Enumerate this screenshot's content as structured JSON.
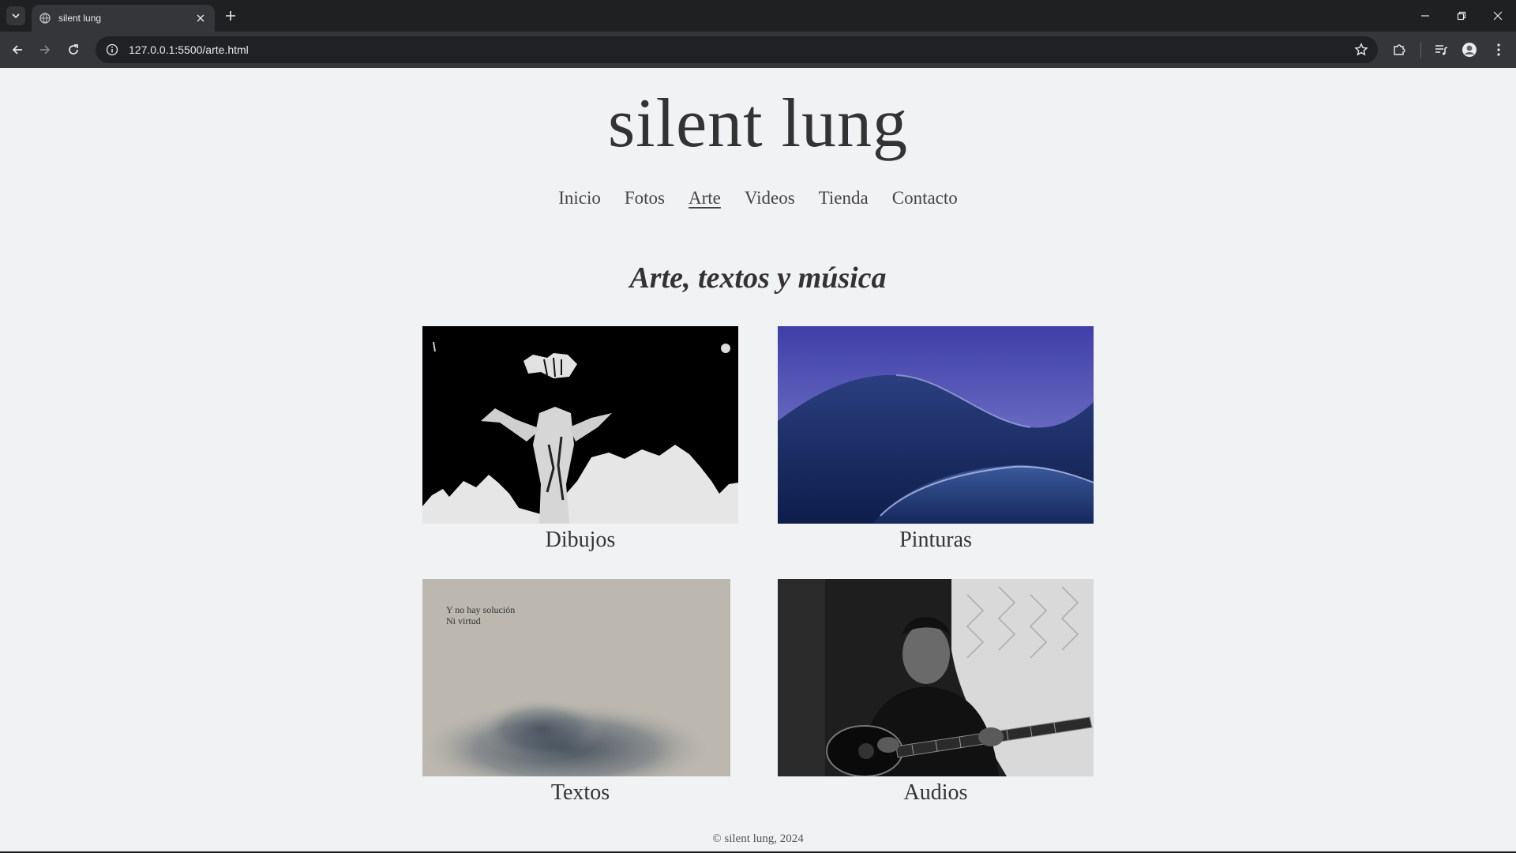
{
  "browser": {
    "tab_title": "silent lung",
    "url": "127.0.0.1:5500/arte.html"
  },
  "site": {
    "title": "silent lung",
    "nav": [
      "Inicio",
      "Fotos",
      "Arte",
      "Videos",
      "Tienda",
      "Contacto"
    ],
    "active_nav": "Arte",
    "section_title": "Arte, textos y música",
    "cards": [
      {
        "caption": "Dibujos"
      },
      {
        "caption": "Pinturas"
      },
      {
        "caption": "Textos",
        "image_text": [
          "Y no hay solución",
          "Ni virtud"
        ]
      },
      {
        "caption": "Audios"
      }
    ],
    "footer": "© silent lung, 2024"
  },
  "icons": {
    "tab_menu": "chevron-down-icon",
    "favicon": "globe-icon",
    "tab_close": "close-icon",
    "new_tab": "plus-icon",
    "back": "arrow-left-icon",
    "forward": "arrow-right-icon",
    "reload": "reload-icon",
    "site_info": "info-icon",
    "bookmark": "star-icon",
    "extensions": "puzzle-icon",
    "media": "media-queue-icon",
    "profile": "avatar-icon",
    "menu": "kebab-menu-icon",
    "minimize": "minimize-icon",
    "restore": "restore-icon",
    "close_window": "close-icon"
  },
  "colors": {
    "page_bg": "#f1f2f4",
    "chrome_dark": "#1f2022",
    "chrome_toolbar": "#35363a"
  }
}
